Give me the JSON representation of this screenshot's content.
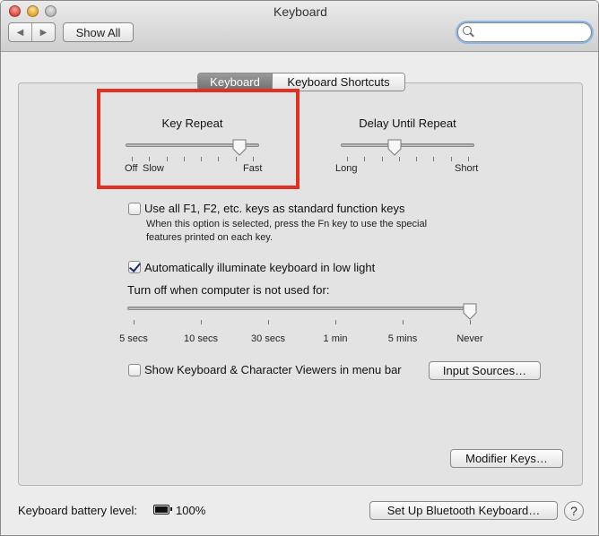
{
  "window": {
    "title": "Keyboard"
  },
  "toolbar": {
    "back_icon": "chevron-left-icon",
    "forward_icon": "chevron-right-icon",
    "show_all_label": "Show All",
    "search_value": ""
  },
  "tabs": [
    {
      "label": "Keyboard",
      "selected": true
    },
    {
      "label": "Keyboard Shortcuts",
      "selected": false
    }
  ],
  "key_repeat": {
    "title": "Key Repeat",
    "left_labels": [
      "Off",
      "Slow"
    ],
    "right_label": "Fast",
    "value_fraction": 0.85
  },
  "delay_until_repeat": {
    "title": "Delay Until Repeat",
    "left_label": "Long",
    "right_label": "Short",
    "value_fraction": 0.4
  },
  "function_keys": {
    "checked": false,
    "label": "Use all F1, F2, etc. keys as standard function keys",
    "description_line1": "When this option is selected, press the Fn key to use the special",
    "description_line2": "features printed on each key."
  },
  "illuminate": {
    "checked": true,
    "label": "Automatically illuminate keyboard in low light"
  },
  "turn_off": {
    "label": "Turn off when computer is not used for:",
    "ticks": [
      "5 secs",
      "10 secs",
      "30 secs",
      "1 min",
      "5 mins",
      "Never"
    ],
    "selected": "Never"
  },
  "viewers": {
    "checked": false,
    "label": "Show Keyboard & Character Viewers in menu bar"
  },
  "buttons": {
    "input_sources": "Input Sources…",
    "modifier_keys": "Modifier Keys…",
    "bluetooth_setup": "Set Up Bluetooth Keyboard…",
    "help": "?"
  },
  "battery": {
    "label": "Keyboard battery level:",
    "percent_text": "100%",
    "level_fraction": 1.0
  },
  "colors": {
    "highlight": "#e33022",
    "selected_tab": "#7a7a7a",
    "checkmark": "#1c2f66"
  }
}
